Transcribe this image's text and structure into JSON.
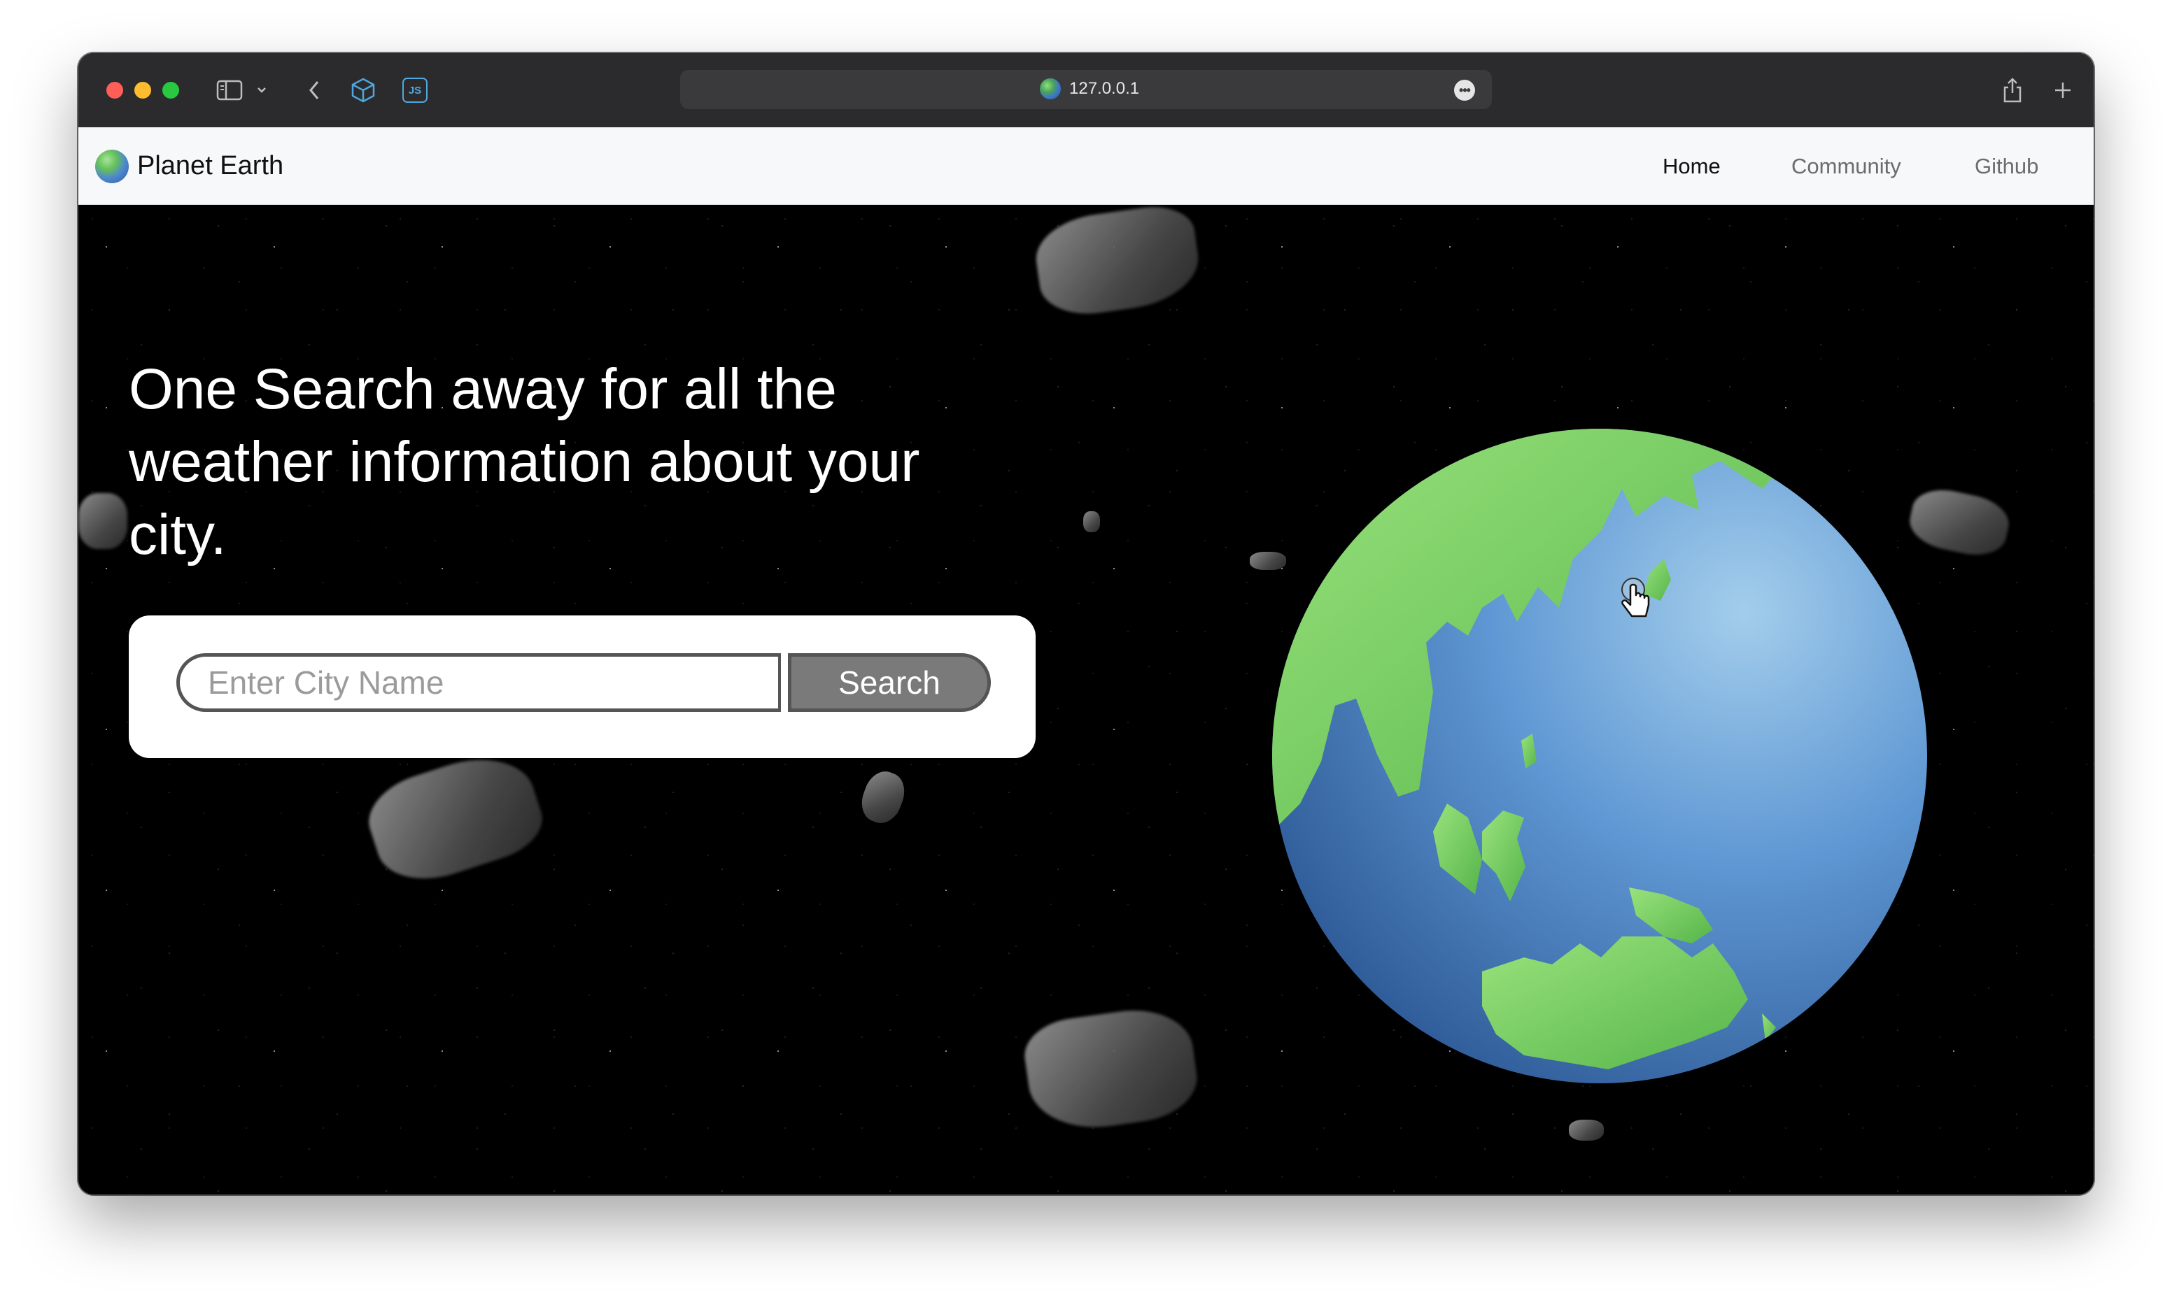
{
  "browser": {
    "address": "127.0.0.1",
    "more_label": "•••",
    "icons": [
      "sidebar-icon",
      "chevron-down-icon",
      "back-icon",
      "extension-cube-icon",
      "js-extension-icon",
      "share-icon",
      "new-tab-icon"
    ],
    "js_badge": "JS"
  },
  "navbar": {
    "brand": "Planet Earth",
    "links": [
      {
        "label": "Home",
        "active": true
      },
      {
        "label": "Community",
        "active": false
      },
      {
        "label": "Github",
        "active": false
      }
    ]
  },
  "hero": {
    "headline": "One Search away for all the weather information about your city.",
    "search": {
      "placeholder": "Enter City Name",
      "value": "",
      "button_label": "Search"
    }
  },
  "colors": {
    "titlebar": "#2b2b2d",
    "navbar": "#f7f8fa",
    "space": "#000000",
    "ocean": "#4a82c4",
    "land": "#78d15a",
    "button": "#7a7a7a"
  }
}
